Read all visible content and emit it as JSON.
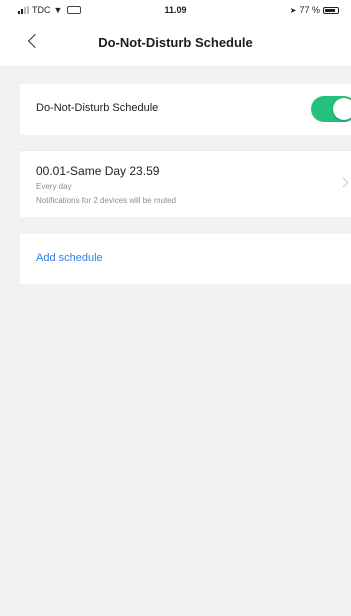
{
  "status_bar": {
    "carrier": "TDC",
    "time": "11.09",
    "battery": "77 %"
  },
  "nav": {
    "title": "Do-Not-Disturb Schedule"
  },
  "dnd": {
    "label": "Do-Not-Disturb Schedule",
    "enabled": true
  },
  "schedule": {
    "time_range": "00.01-Same Day 23.59",
    "repeat": "Every day",
    "note": "Notifications for 2 devices will be muted"
  },
  "add": {
    "label": "Add schedule"
  },
  "colors": {
    "toggle_on": "#25c07e",
    "link": "#2f80ed",
    "background": "#f2f2f4"
  }
}
